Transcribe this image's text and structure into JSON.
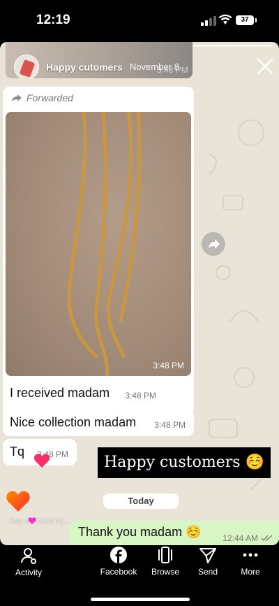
{
  "status": {
    "time": "12:19",
    "battery": "37"
  },
  "story": {
    "name": "Happy cutomers",
    "date": "November 8",
    "faint_time": "3:48 PM",
    "forwarded_label": "Forwarded",
    "photo_time": "3:48 PM",
    "messages": [
      {
        "text": "I received madam",
        "time": "3:48 PM"
      },
      {
        "text": "Nice collection madam",
        "time": "3:48 PM"
      },
      {
        "text": "Tq",
        "time": "3:48 PM"
      }
    ],
    "caption": "Happy customers ☺️",
    "date_divider": "Today",
    "outgoing": {
      "text": "Thank you madam ☺️",
      "time": "12:44 AM"
    },
    "reply_placeholder": "Say something..."
  },
  "tabs": [
    {
      "label": "Activity",
      "icon": "activity-person-icon"
    },
    {
      "label": "Facebook",
      "icon": "facebook-icon"
    },
    {
      "label": "Browse",
      "icon": "browse-cards-icon"
    },
    {
      "label": "Send",
      "icon": "send-paper-plane-icon"
    },
    {
      "label": "More",
      "icon": "more-dots-icon"
    }
  ],
  "colors": {
    "caption_bg": "#000000",
    "outgoing_bubble": "#d8f5c4",
    "heart": "#ff2d6a"
  }
}
